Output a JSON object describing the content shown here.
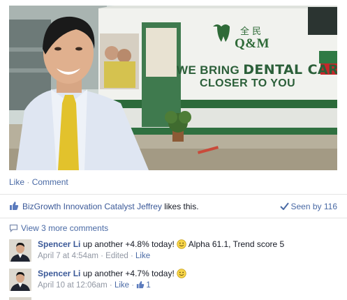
{
  "photo": {
    "truck_brand": "Q&M",
    "truck_chinese": "全 民",
    "truck_line1_a": "WE BRING ",
    "truck_line1_b": "DENTAL CARE",
    "truck_line2": "CLOSER TO YOU"
  },
  "actions": {
    "like": "Like",
    "sep": " · ",
    "comment": "Comment"
  },
  "likes": {
    "actor": "BizGrowth Innovation Catalyst Jeffrey",
    "suffix": " likes this.",
    "seen": "Seen by 116"
  },
  "more_comments": "View 3 more comments",
  "comments": [
    {
      "author": "Spencer Li",
      "text_a": " up another +4.8% today! ",
      "text_b": " Alpha 61.1, Trend score 5",
      "date": "April 7 at 4:54am",
      "sep": " · ",
      "edited": "Edited",
      "like": "Like"
    },
    {
      "author": "Spencer Li",
      "text_a": " up another +4.7% today! ",
      "text_b": "",
      "date": "April 10 at 12:06am",
      "sep": " · ",
      "like": "Like",
      "like_count": "1"
    }
  ],
  "colors": {
    "link": "#3b5998",
    "muted": "#9197a3",
    "divider": "#e5e5e5",
    "brand_green": "#2f6b38"
  },
  "icons": [
    "thumbs-up-icon",
    "checkmark-icon",
    "comment-bubble-icon",
    "smiley-icon"
  ]
}
